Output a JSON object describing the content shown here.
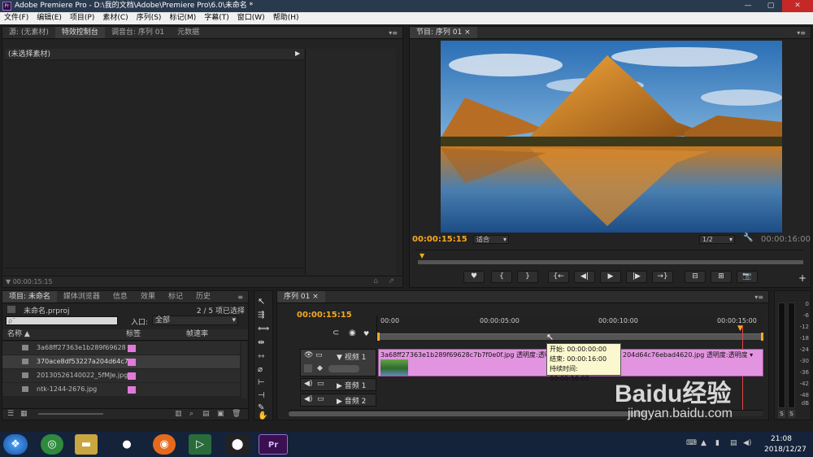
{
  "title": "Adobe Premiere Pro - D:\\我的文档\\Adobe\\Premiere Pro\\6.0\\未命名 *",
  "menu": [
    "文件(F)",
    "编辑(E)",
    "项目(P)",
    "素材(C)",
    "序列(S)",
    "标记(M)",
    "字幕(T)",
    "窗口(W)",
    "帮助(H)"
  ],
  "source_panel": {
    "tabs": [
      "源: (无素材)",
      "特效控制台",
      "调音台: 序列 01",
      "元数据"
    ],
    "no_clip": "(未选择素材)",
    "timecode": "00:00:15:15"
  },
  "program_panel": {
    "tab": "节目: 序列 01",
    "timecode": "00:00:15:15",
    "fit": "适合",
    "resolution": "1/2",
    "duration": "00:00:16:00"
  },
  "project_panel": {
    "tabs": [
      "项目: 未命名",
      "媒体浏览器",
      "信息",
      "效果",
      "标记",
      "历史"
    ],
    "project_file": "未命名.prproj",
    "selection": "2 / 5 项已选择",
    "search_placeholder": "ρ˜",
    "entry_label": "入口:",
    "entry_value": "全部",
    "columns": [
      "名称",
      "标签",
      "帧速率"
    ],
    "items": [
      {
        "name": "3a68ff27363e1b289f69628"
      },
      {
        "name": "370ace8df53227a204d64c7"
      },
      {
        "name": "20130526140022_5fMJe.jpg"
      },
      {
        "name": "ntk-1244-2676.jpg"
      }
    ]
  },
  "timeline_panel": {
    "tab": "序列 01",
    "timecode": "00:00:15:15",
    "ruler": [
      "00:00",
      "00:00:05:00",
      "00:00:10:00",
      "00:00:15:00"
    ],
    "tracks": [
      {
        "label": "视频 1"
      },
      {
        "label": "音频 1"
      },
      {
        "label": "音频 2"
      }
    ],
    "clip_left": "3a68ff27363e1b289f69628c7b7f0e0f.jpg  透明度:透明度 ▾",
    "clip_right": "204d64c76ebad4620.jpg  透明度:透明度 ▾",
    "tooltip": {
      "start": "开始: 00:00:00:00",
      "end": "结束: 00:00:16:00",
      "duration": "持续时间: 00:00:16:00"
    }
  },
  "meter": {
    "ticks": [
      "0",
      "-6",
      "-12",
      "-18",
      "-24",
      "-30",
      "-36",
      "-42",
      "-48",
      "dB"
    ],
    "solo": [
      "S",
      "S"
    ]
  },
  "watermark": {
    "brand": "Baidu经验",
    "url": "jingyan.baidu.com"
  },
  "taskbar": {
    "time": "21:08",
    "date": "2018/12/27"
  }
}
